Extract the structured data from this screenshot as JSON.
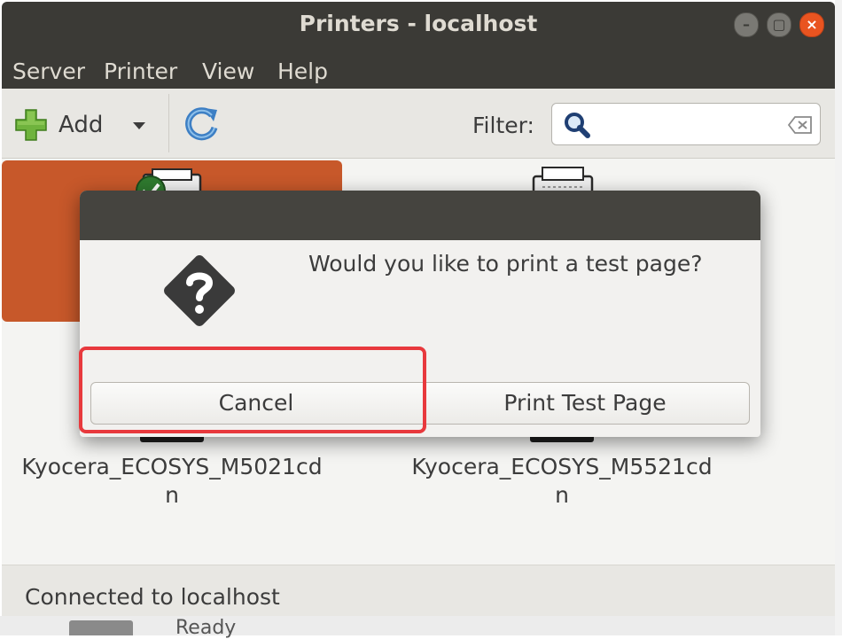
{
  "window": {
    "title": "Printers - localhost",
    "controls": {
      "minimize_glyph": "–",
      "maximize_glyph": "▢",
      "close_glyph": "×"
    }
  },
  "menubar": {
    "items": [
      "Server",
      "Printer",
      "View",
      "Help"
    ]
  },
  "toolbar": {
    "add_label": "Add",
    "add_icon": "green-plus-icon",
    "dropdown_icon": "triangle-down-icon",
    "refresh_icon": "refresh-icon",
    "filter_label": "Filter:",
    "filter_value": "",
    "filter_icons": [
      "search-icon",
      "clear-input-icon"
    ]
  },
  "printers": [
    {
      "name": "Kyocera_ECOSYS_M5021cd\nn",
      "selected": true,
      "status_icon": "checkmark-icon"
    },
    {
      "name": "Kyocera_ECOSYS_M5521cd\nn",
      "selected": false
    }
  ],
  "partially_visible": {
    "bottom_label": "Ready"
  },
  "statusbar": {
    "text": "Connected to localhost"
  },
  "dialog": {
    "icon": "question-icon",
    "message": "Would you like to print a test page?",
    "cancel_label": "Cancel",
    "print_label": "Print Test Page"
  },
  "colors": {
    "titlebar": "#3b3a36",
    "selection": "#c7582a",
    "close_button": "#e95420",
    "highlight": "#e8393d"
  }
}
